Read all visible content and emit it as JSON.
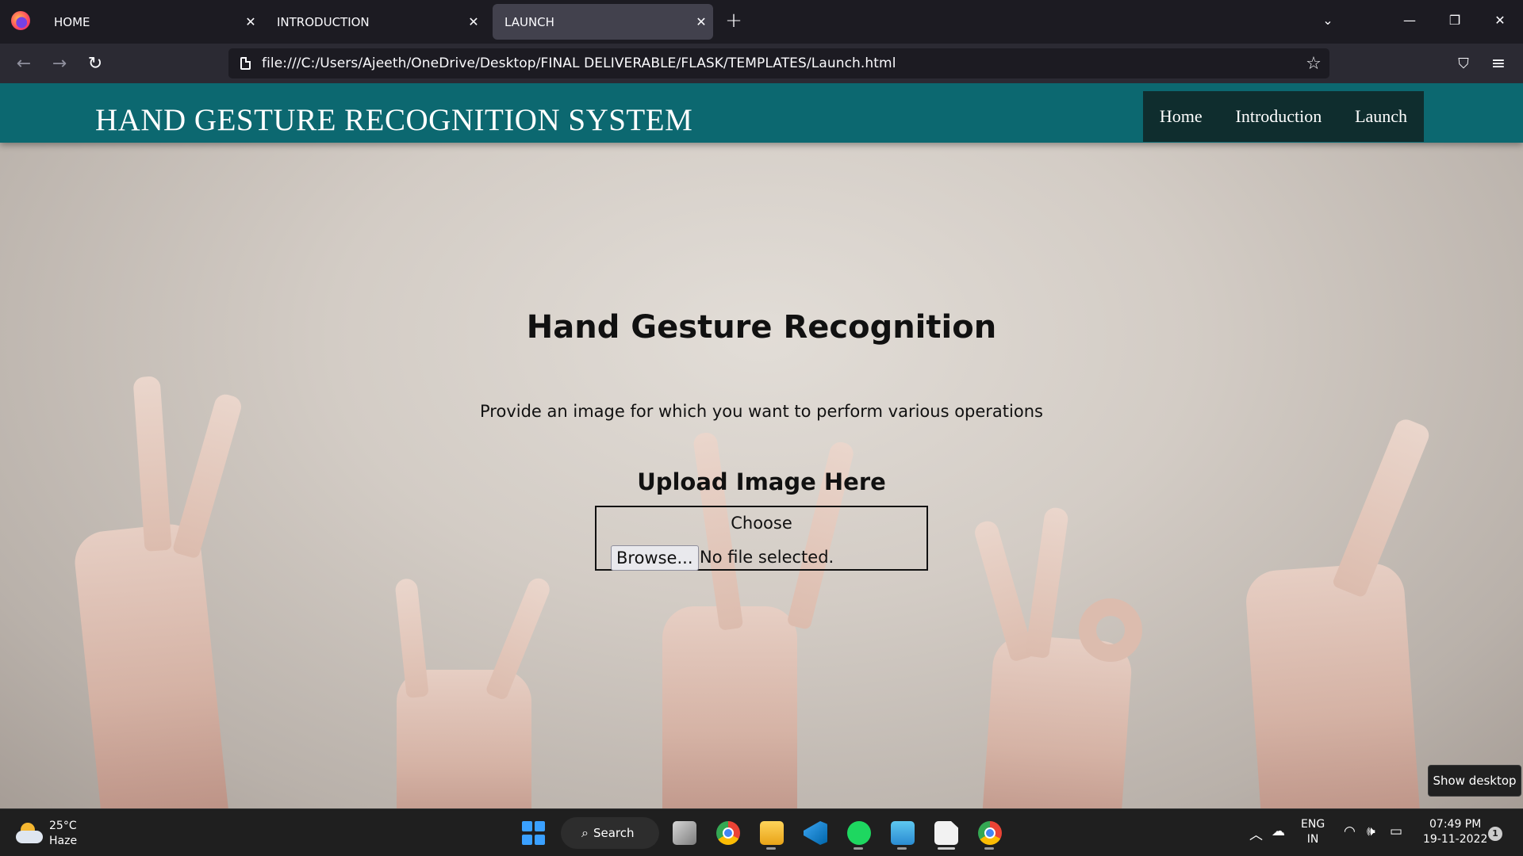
{
  "browser": {
    "tabs": [
      {
        "label": "HOME",
        "active": false
      },
      {
        "label": "INTRODUCTION",
        "active": false
      },
      {
        "label": "LAUNCH",
        "active": true
      }
    ],
    "url": "file:///C:/Users/Ajeeth/OneDrive/Desktop/FINAL DELIVERABLE/FLASK/TEMPLATES/Launch.html"
  },
  "site": {
    "title": "HAND GESTURE RECOGNITION SYSTEM",
    "nav": [
      {
        "label": "Home"
      },
      {
        "label": "Introduction"
      },
      {
        "label": "Launch"
      }
    ],
    "heading": "Hand Gesture Recognition",
    "description": "Provide an image for which you want to perform various operations",
    "upload": {
      "heading": "Upload Image Here",
      "choose_label": "Choose",
      "browse_button": "Browse...",
      "file_status": "No file selected."
    }
  },
  "tooltip": {
    "show_desktop": "Show desktop"
  },
  "taskbar": {
    "weather": {
      "temp": "25°C",
      "condition": "Haze"
    },
    "search_label": "Search",
    "language": {
      "line1": "ENG",
      "line2": "IN"
    },
    "clock": {
      "time": "07:49 PM",
      "date": "19-11-2022"
    },
    "notification_count": "1"
  },
  "colors": {
    "header_bg": "#0c6870",
    "nav_bg": "#0f2d2e",
    "browser_bg": "#1c1b22",
    "active_tab": "#42414d"
  }
}
